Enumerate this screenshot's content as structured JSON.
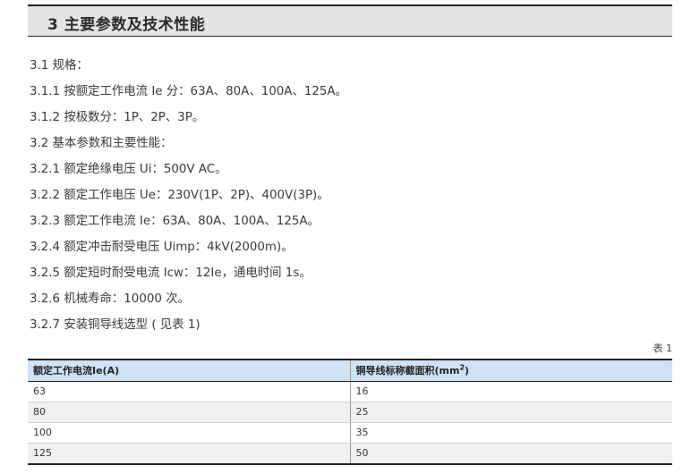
{
  "section": {
    "title": "3 主要参数及技术性能"
  },
  "spec_lines": [
    "3.1 规格：",
    "3.1.1 按额定工作电流 Ie 分：63A、80A、100A、125A。",
    "3.1.2 按极数分：1P、2P、3P。",
    "3.2 基本参数和主要性能：",
    "3.2.1 额定绝缘电压 Ui：500V AC。",
    "3.2.2 额定工作电压 Ue：230V(1P、2P)、400V(3P)。",
    "3.2.3 额定工作电流 Ie：63A、80A、100A、125A。",
    "3.2.4 额定冲击耐受电压 Uimp：4kV(2000m)。",
    "3.2.5 额定短时耐受电流 Icw：12Ie，通电时间 1s。",
    "3.2.6 机械寿命：10000 次。",
    "3.2.7 安装铜导线选型 ( 见表 1)"
  ],
  "table": {
    "caption": "表 1",
    "headers": [
      "额定工作电流Ie(A)",
      "铜导线标称截面积(mm",
      "2",
      ")"
    ],
    "rows": [
      [
        "63",
        "16"
      ],
      [
        "80",
        "25"
      ],
      [
        "100",
        "35"
      ],
      [
        "125",
        "50"
      ]
    ]
  }
}
